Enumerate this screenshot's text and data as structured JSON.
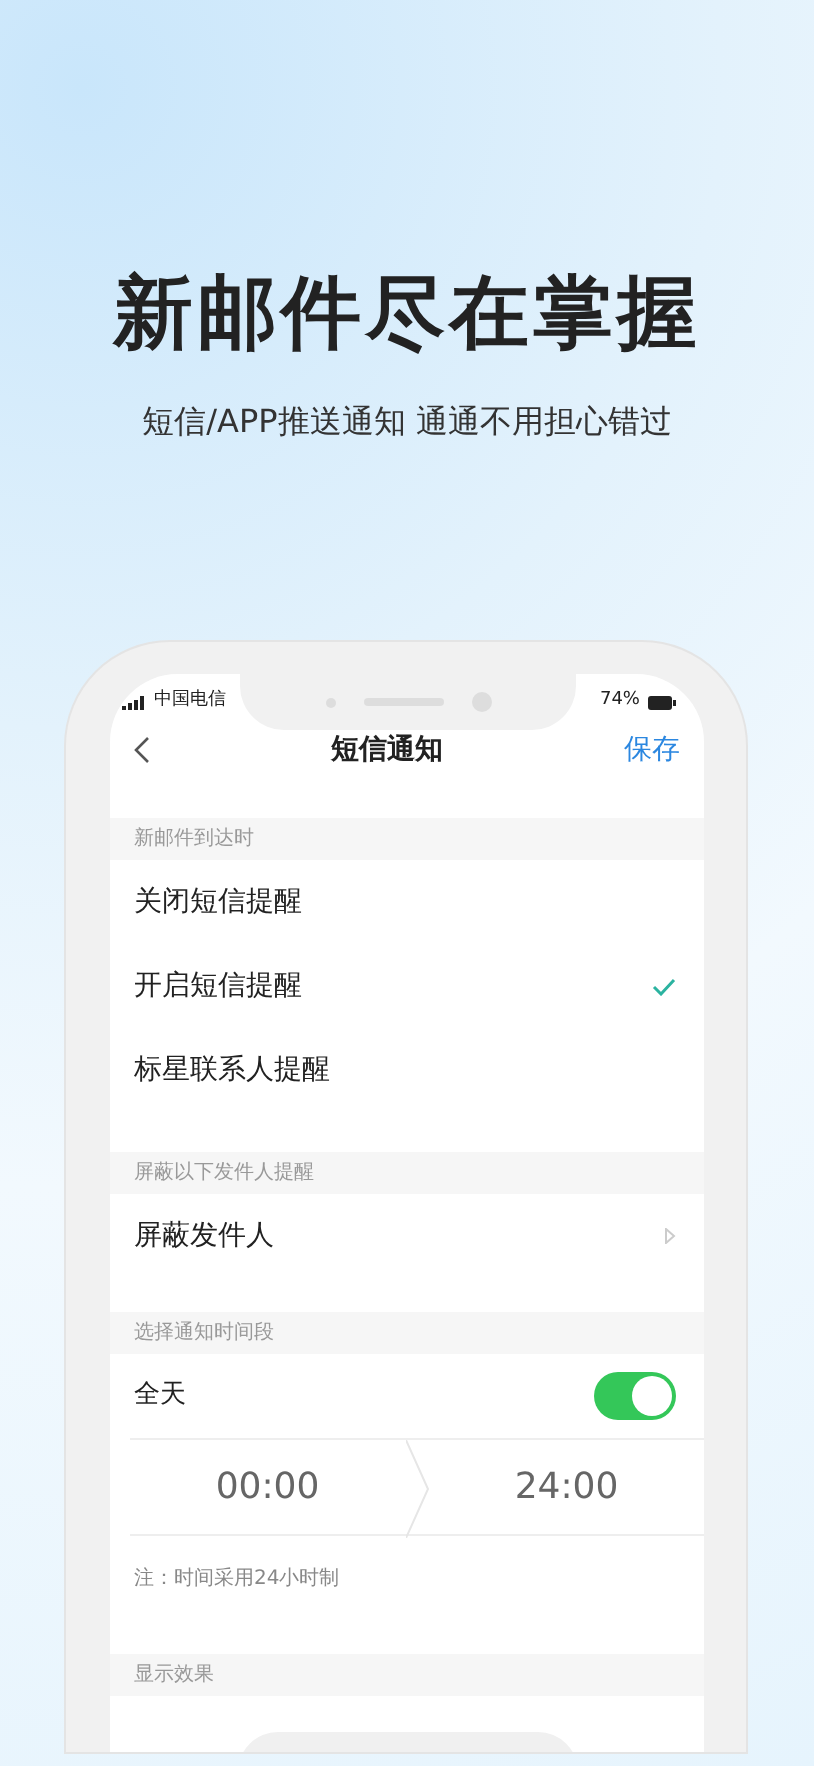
{
  "headline": "新邮件尽在掌握",
  "subheadline": "短信/APP推送通知 通通不用担心错过",
  "status_bar": {
    "carrier": "中国电信",
    "battery": "74%"
  },
  "nav": {
    "title": "短信通知",
    "action": "保存"
  },
  "sections": [
    {
      "header": "新邮件到达时",
      "kind": "options",
      "items": [
        {
          "label": "关闭短信提醒",
          "selected": false
        },
        {
          "label": "开启短信提醒",
          "selected": true
        },
        {
          "label": "标星联系人提醒",
          "selected": false
        }
      ]
    },
    {
      "header": "屏蔽以下发件人提醒",
      "kind": "link",
      "items": [
        {
          "label": "屏蔽发件人"
        }
      ]
    },
    {
      "header": "选择通知时间段",
      "kind": "time",
      "toggle": {
        "label": "全天",
        "on": true
      },
      "start": "00:00",
      "end": "24:00",
      "note": "注：时间采用24小时制"
    },
    {
      "header": "显示效果",
      "kind": "preview"
    }
  ]
}
